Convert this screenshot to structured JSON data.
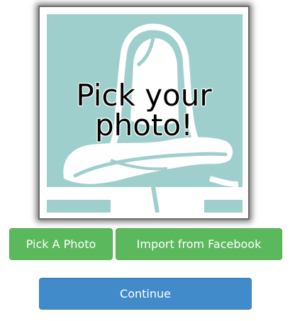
{
  "photo_picker": {
    "overlay_line1": "Pick your",
    "overlay_line2": "photo!",
    "placeholder_icon": "silhouette-placeholder-icon",
    "placeholder_bg_color": "#9ecfcc"
  },
  "actions": {
    "pick_photo_label": "Pick A Photo",
    "import_facebook_label": "Import from Facebook",
    "continue_label": "Continue"
  },
  "colors": {
    "success_green": "#5cb85c",
    "primary_blue": "#428bca"
  }
}
